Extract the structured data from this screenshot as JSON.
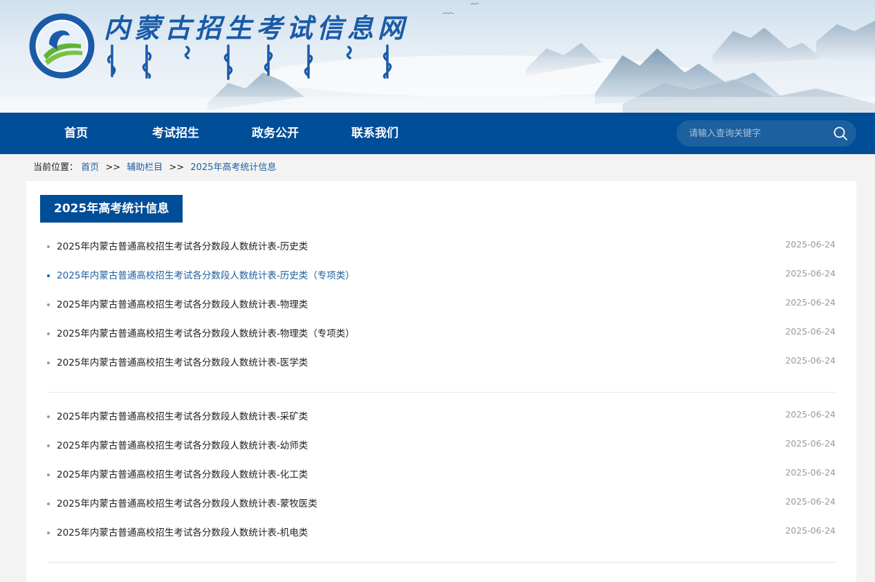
{
  "header": {
    "site_title": "内蒙古招生考试信息网",
    "logo_icon": "exam-authority-emblem-icon"
  },
  "nav": {
    "items": [
      {
        "label": "首页"
      },
      {
        "label": "考试招生"
      },
      {
        "label": "政务公开"
      },
      {
        "label": "联系我们"
      }
    ],
    "search": {
      "placeholder": "请输入查询关键字",
      "value": ""
    }
  },
  "breadcrumb": {
    "prefix": "当前位置：",
    "items": [
      "首页",
      "辅助栏目",
      "2025年高考统计信息"
    ],
    "separator": ">>"
  },
  "section": {
    "title": "2025年高考统计信息"
  },
  "colors": {
    "primary": "#004d98",
    "link": "#1d609f",
    "date": "#999999"
  },
  "list_groups": [
    {
      "items": [
        {
          "title": "2025年内蒙古普通高校招生考试各分数段人数统计表-历史类",
          "date": "2025-06-24"
        },
        {
          "title": "2025年内蒙古普通高校招生考试各分数段人数统计表-历史类（专项类）",
          "date": "2025-06-24"
        },
        {
          "title": "2025年内蒙古普通高校招生考试各分数段人数统计表-物理类",
          "date": "2025-06-24"
        },
        {
          "title": "2025年内蒙古普通高校招生考试各分数段人数统计表-物理类（专项类）",
          "date": "2025-06-24"
        },
        {
          "title": "2025年内蒙古普通高校招生考试各分数段人数统计表-医学类",
          "date": "2025-06-24"
        }
      ]
    },
    {
      "items": [
        {
          "title": "2025年内蒙古普通高校招生考试各分数段人数统计表-采矿类",
          "date": "2025-06-24"
        },
        {
          "title": "2025年内蒙古普通高校招生考试各分数段人数统计表-幼师类",
          "date": "2025-06-24"
        },
        {
          "title": "2025年内蒙古普通高校招生考试各分数段人数统计表-化工类",
          "date": "2025-06-24"
        },
        {
          "title": "2025年内蒙古普通高校招生考试各分数段人数统计表-蒙牧医类",
          "date": "2025-06-24"
        },
        {
          "title": "2025年内蒙古普通高校招生考试各分数段人数统计表-机电类",
          "date": "2025-06-24"
        }
      ]
    }
  ]
}
